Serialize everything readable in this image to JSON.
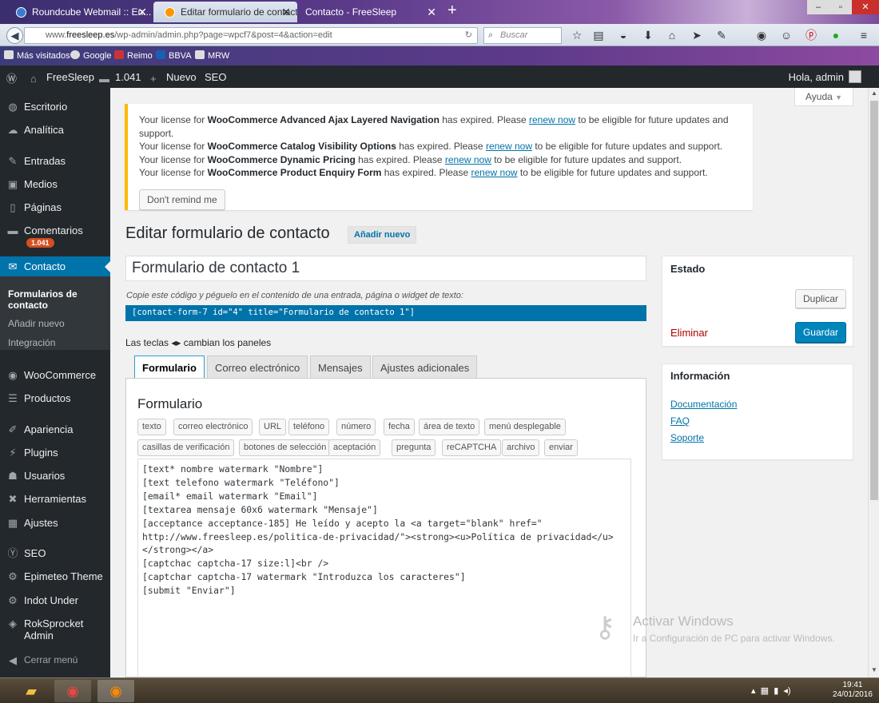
{
  "browser": {
    "tabs": [
      {
        "label": "Roundcube Webmail :: En..."
      },
      {
        "label": "Editar formulario de contacto ..."
      },
      {
        "label": "Contacto - FreeSleep"
      }
    ],
    "url_prefix": "www.",
    "url_domain": "freesleep.es",
    "url_path": "/wp-admin/admin.php?page=wpcf7&post=4&action=edit",
    "search_placeholder": "Buscar",
    "bookmarks": [
      "Más visitados",
      "Google",
      "Reimo",
      "BBVA",
      "MRW"
    ]
  },
  "adminbar": {
    "site": "FreeSleep",
    "comments": "1.041",
    "new": "Nuevo",
    "seo": "SEO",
    "greeting": "Hola, admin"
  },
  "sidebar": {
    "items": [
      {
        "label": "Escritorio"
      },
      {
        "label": "Analítica"
      },
      {
        "label": "Entradas"
      },
      {
        "label": "Medios"
      },
      {
        "label": "Páginas"
      },
      {
        "label": "Comentarios"
      },
      {
        "label": "Contacto"
      },
      {
        "label": "WooCommerce"
      },
      {
        "label": "Productos"
      },
      {
        "label": "Apariencia"
      },
      {
        "label": "Plugins"
      },
      {
        "label": "Usuarios"
      },
      {
        "label": "Herramientas"
      },
      {
        "label": "Ajustes"
      },
      {
        "label": "SEO"
      },
      {
        "label": "Epimeteo Theme"
      },
      {
        "label": "Indot Under"
      },
      {
        "label": "RokSprocket Admin"
      },
      {
        "label": "Cerrar menú"
      }
    ],
    "comments_badge": "1.041",
    "submenu": [
      "Formularios de contacto",
      "Añadir nuevo",
      "Integración"
    ]
  },
  "help": "Ayuda",
  "notices": [
    {
      "pre": "Your license for ",
      "product": "WooCommerce Advanced Ajax Layered Navigation",
      "mid": " has expired. Please ",
      "link": "renew now",
      "post": " to be eligible for future updates and support."
    },
    {
      "pre": "Your license for ",
      "product": "WooCommerce Catalog Visibility Options",
      "mid": " has expired. Please ",
      "link": "renew now",
      "post": " to be eligible for future updates and support."
    },
    {
      "pre": "Your license for ",
      "product": "WooCommerce Dynamic Pricing",
      "mid": " has expired. Please ",
      "link": "renew now",
      "post": " to be eligible for future updates and support."
    },
    {
      "pre": "Your license for ",
      "product": "WooCommerce Product Enquiry Form",
      "mid": " has expired. Please ",
      "link": "renew now",
      "post": " to be eligible for future updates and support."
    }
  ],
  "dont_remind": "Don't remind me",
  "page_title": "Editar formulario de contacto",
  "add_new": "Añadir nuevo",
  "form_title": "Formulario de contacto 1",
  "copy_hint": "Copie este código y péguelo en el contenido de una entrada, página o widget de texto:",
  "shortcode": "[contact-form-7 id=\"4\" title=\"Formulario de contacto 1\"]",
  "keys_hint_pre": "Las teclas",
  "keys_hint_glyph": "◂▸",
  "keys_hint_post": "cambian los paneles",
  "tabs": [
    "Formulario",
    "Correo electrónico",
    "Mensajes",
    "Ajustes adicionales"
  ],
  "panel_title": "Formulario",
  "tag_buttons_row1": [
    "texto",
    "correo electrónico",
    "URL",
    "teléfono",
    "número",
    "fecha",
    "área de texto",
    "menú desplegable"
  ],
  "tag_buttons_row2": [
    "casillas de verificación",
    "botones de selección",
    "aceptación",
    "pregunta",
    "reCAPTCHA",
    "archivo",
    "enviar"
  ],
  "form_code": "[text* nombre watermark \"Nombre\"]\n[text telefono watermark \"Teléfono\"]\n[email* email watermark \"Email\"]\n[textarea mensaje 60x6 watermark \"Mensaje\"]\n[acceptance acceptance-185] He leído y acepto la <a target=\"blank\" href=\"\nhttp://www.freesleep.es/politica-de-privacidad/\"><strong><u>Política de privacidad</u>\n</strong></a>\n[captchac captcha-17 size:l]<br />\n[captchar captcha-17 watermark \"Introduzca los caracteres\"]\n[submit \"Enviar\"]",
  "status_box": {
    "title": "Estado",
    "duplicate": "Duplicar",
    "delete": "Eliminar",
    "save": "Guardar"
  },
  "info_box": {
    "title": "Información",
    "links": [
      "Documentación",
      "FAQ",
      "Soporte"
    ]
  },
  "watermark": {
    "line1": "Activar Windows",
    "line2": "Ir a Configuración de PC para activar Windows."
  },
  "clock": {
    "time": "19:41",
    "date": "24/01/2016"
  }
}
